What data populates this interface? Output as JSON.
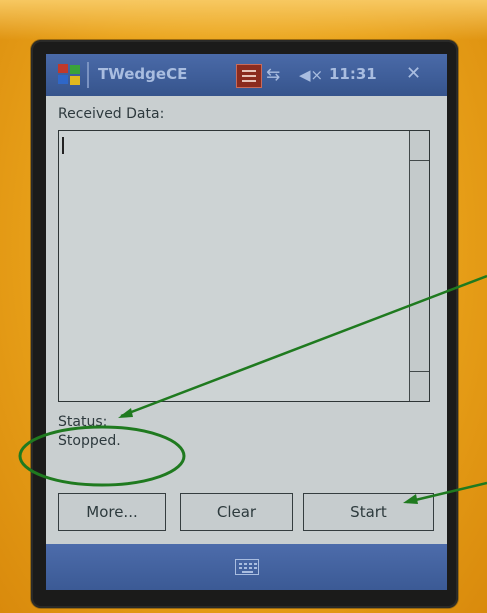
{
  "titlebar": {
    "title": "TWedgeCE",
    "time": "11:31",
    "icons": [
      "windows-start-icon",
      "keyboard-status-icon",
      "network-icon",
      "volume-muted-icon",
      "close-icon"
    ],
    "close_glyph": "✕",
    "network_glyph": "⇆",
    "volume_glyph": "◀×"
  },
  "received": {
    "label": "Received Data:",
    "value": ""
  },
  "status": {
    "caption": "Status:",
    "value": "Stopped."
  },
  "buttons": {
    "more": "More...",
    "clear": "Clear",
    "start": "Start"
  },
  "softbar": {
    "icons": [
      "keyboard-icon"
    ]
  },
  "colors": {
    "device_case": "#e9a21a",
    "titlebar": "#3e5d98",
    "screen_bg": "#c9cfd0",
    "annotation": "#1f7a1f"
  }
}
